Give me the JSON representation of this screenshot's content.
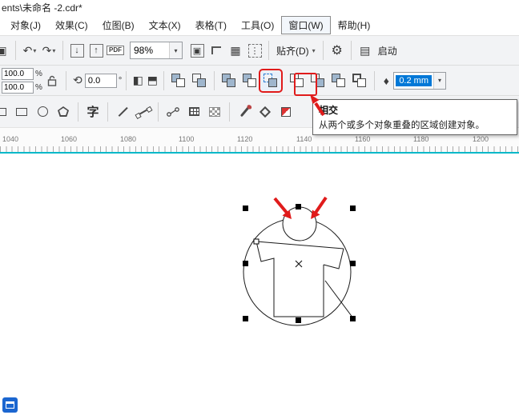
{
  "titlebar": {
    "title": "ents\\未命名 -2.cdr*"
  },
  "menu": {
    "items": [
      {
        "label": "对象(J)"
      },
      {
        "label": "效果(C)"
      },
      {
        "label": "位图(B)"
      },
      {
        "label": "文本(X)"
      },
      {
        "label": "表格(T)"
      },
      {
        "label": "工具(O)"
      },
      {
        "label": "窗口(W)"
      },
      {
        "label": "帮助(H)"
      }
    ]
  },
  "toolbar": {
    "zoom_value": "98%",
    "pdf_label": "PDF",
    "snap_label": "贴齐(D)",
    "launch_label": "启动"
  },
  "property_bar": {
    "scale_x": "100.0",
    "scale_y": "100.0",
    "percent": "%",
    "rotation": "0.0",
    "degree": "°",
    "outline_width": "0.2 mm"
  },
  "toolbox": {
    "text_tool": "字"
  },
  "tooltip": {
    "title": "相交",
    "body": "从两个或多个对象重叠的区域创建对象。"
  },
  "ruler": {
    "ticks": [
      "1040",
      "1060",
      "1080",
      "1100",
      "1120",
      "1140",
      "1160",
      "1180",
      "1200"
    ]
  },
  "icons": {
    "undo": "↶",
    "redo": "↷",
    "dropdown": "▾",
    "import": "↓",
    "export": "↑",
    "gear": "⚙",
    "grid": "▦",
    "page": "▤",
    "rulers": "⊫",
    "monitor": "▭",
    "pen_nib": "♦",
    "launch": "▶"
  },
  "colors": {
    "annotation_red": "#e01b1b",
    "selection_blue": "#0078d7",
    "guide_teal": "#00b8c8"
  }
}
